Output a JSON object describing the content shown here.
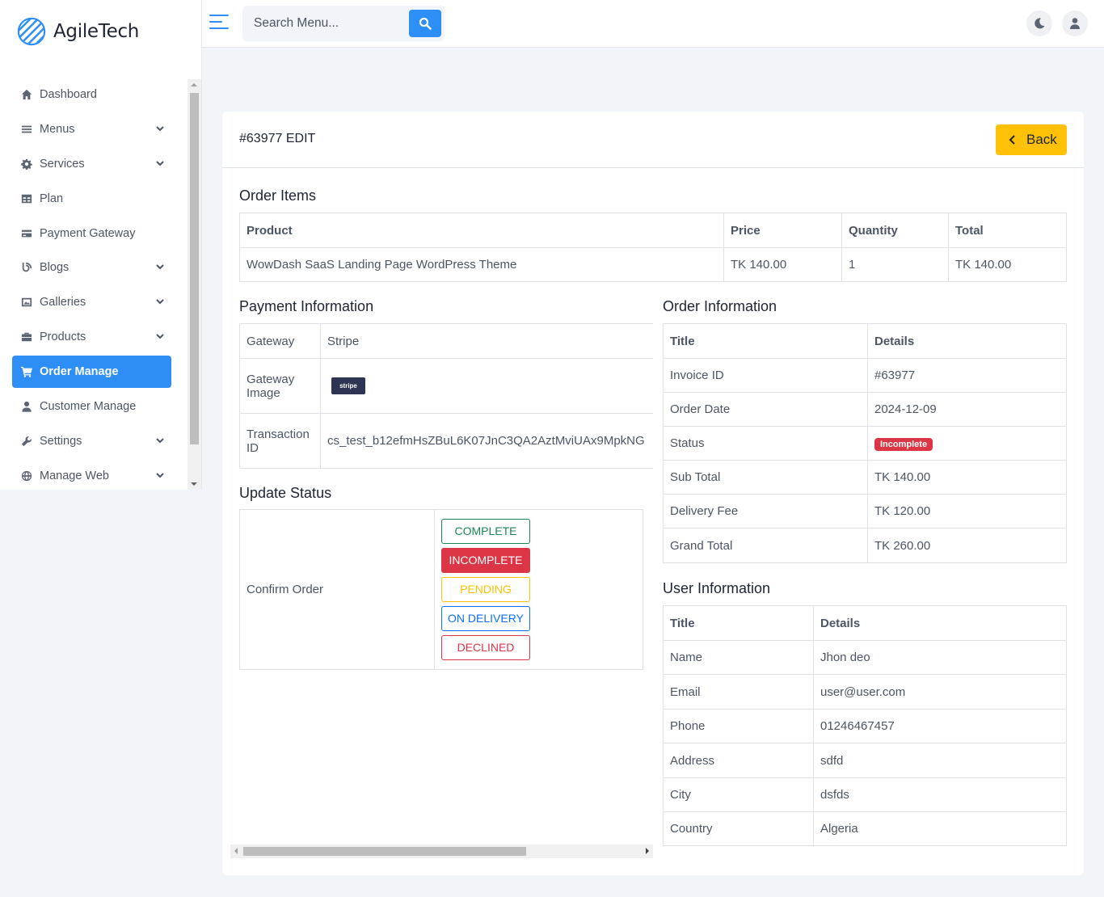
{
  "brand": {
    "name": "AgileTech"
  },
  "sidebar": {
    "items": [
      {
        "label": "Dashboard",
        "icon": "home-icon",
        "has_children": false
      },
      {
        "label": "Menus",
        "icon": "bars-icon",
        "has_children": true
      },
      {
        "label": "Services",
        "icon": "gear-icon",
        "has_children": true
      },
      {
        "label": "Plan",
        "icon": "table-icon",
        "has_children": false
      },
      {
        "label": "Payment Gateway",
        "icon": "credit-card-icon",
        "has_children": false
      },
      {
        "label": "Blogs",
        "icon": "blog-icon",
        "has_children": true
      },
      {
        "label": "Galleries",
        "icon": "image-icon",
        "has_children": true
      },
      {
        "label": "Products",
        "icon": "briefcase-icon",
        "has_children": true
      },
      {
        "label": "Order Manage",
        "icon": "cart-icon",
        "has_children": false,
        "active": true
      },
      {
        "label": "Customer Manage",
        "icon": "user-icon",
        "has_children": false
      },
      {
        "label": "Settings",
        "icon": "wrench-icon",
        "has_children": true
      },
      {
        "label": "Manage Web",
        "icon": "globe-icon",
        "has_children": true
      }
    ]
  },
  "topbar": {
    "search_placeholder": "Search Menu..."
  },
  "page": {
    "title": "#63977 EDIT",
    "back_label": "Back"
  },
  "order_items": {
    "title": "Order Items",
    "headers": [
      "Product",
      "Price",
      "Quantity",
      "Total"
    ],
    "rows": [
      [
        "WowDash SaaS Landing Page WordPress Theme",
        "TK 140.00",
        "1",
        "TK 140.00"
      ]
    ]
  },
  "payment": {
    "title": "Payment Information",
    "gateway_label": "Gateway",
    "gateway_value": "Stripe",
    "image_label_1": "Gateway",
    "image_label_2": "Image",
    "stripe_logo_text": "stripe",
    "txn_label_1": "Transaction",
    "txn_label_2": "ID",
    "txn_value": "cs_test_b12efmHsZBuL6K07JnC3QA2AztMviUAx9MpkNG"
  },
  "update_status": {
    "title": "Update Status",
    "label": "Confirm Order",
    "buttons": [
      "COMPLETE",
      "INCOMPLETE",
      "PENDING",
      "ON DELIVERY",
      "DECLINED"
    ]
  },
  "order_info": {
    "title": "Order Information",
    "headers": [
      "Title",
      "Details"
    ],
    "rows": [
      [
        "Invoice ID",
        "#63977"
      ],
      [
        "Order Date",
        "2024-12-09"
      ],
      [
        "Status",
        "Incomplete"
      ],
      [
        "Sub Total",
        "TK 140.00"
      ],
      [
        "Delivery Fee",
        "TK 120.00"
      ],
      [
        "Grand Total",
        "TK 260.00"
      ]
    ]
  },
  "user_info": {
    "title": "User Information",
    "headers": [
      "Title",
      "Details"
    ],
    "rows": [
      [
        "Name",
        "Jhon deo"
      ],
      [
        "Email",
        "user@user.com"
      ],
      [
        "Phone",
        "01246467457"
      ],
      [
        "Address",
        "sdfd"
      ],
      [
        "City",
        "dsfds"
      ],
      [
        "Country",
        "Algeria"
      ]
    ]
  },
  "colors": {
    "primary": "#2d8ef5",
    "warning": "#ffc107",
    "danger": "#dc3545",
    "success": "#198754",
    "info": "#0d6efd"
  }
}
